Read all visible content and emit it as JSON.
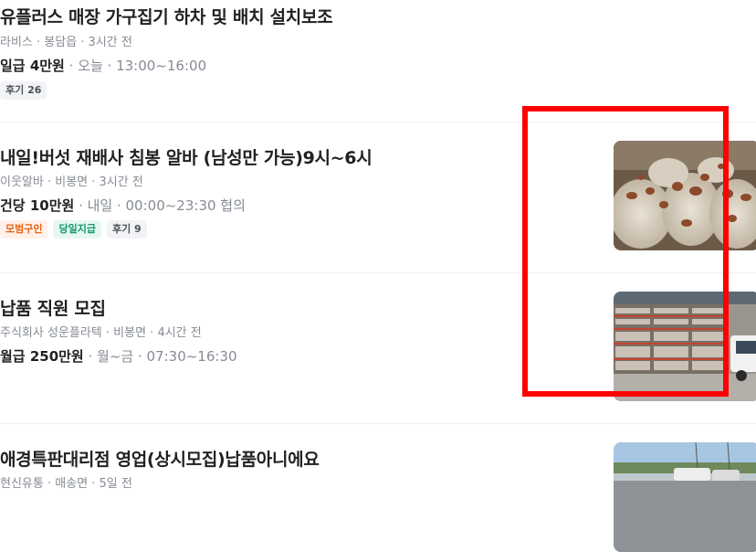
{
  "jobs": [
    {
      "title": "유플러스 매장 가구집기 하차 및 배치 설치보조",
      "meta": "라비스 · 봉담읍 · 3시간 전",
      "pay": "일급 4만원",
      "schedule": " · 오늘 · 13:00~16:00",
      "tags": [
        "후기 26"
      ]
    },
    {
      "title": "내일!버섯 재배사 침봉 알바 (남성만 가능)9시~6시",
      "meta": "이웃알바 · 비봉면 · 3시간 전",
      "pay": "건당 10만원",
      "schedule": " · 내일 · 00:00~23:30 협의",
      "tags": [
        "모범구인",
        "당일지급",
        "후기 9"
      ],
      "thumbnail": "mushroom-farm-photo"
    },
    {
      "title": "납품 직원 모집",
      "meta": "주식회사 성운플라텍 · 비봉면 · 4시간 전",
      "pay": "월급 250만원",
      "schedule": " · 월~금 · 07:30~16:30",
      "tags": [],
      "thumbnail": "warehouse-truck-photo"
    },
    {
      "title": "애경특판대리점 영업(상시모집)납품아니에요",
      "meta": "현신유통 · 매송면 · 5일 전",
      "thumbnail": "parking-lot-photo"
    }
  ],
  "colors": {
    "highlight": "#ff0000",
    "tag_orange": "#e9620f",
    "tag_green": "#129a6b"
  }
}
